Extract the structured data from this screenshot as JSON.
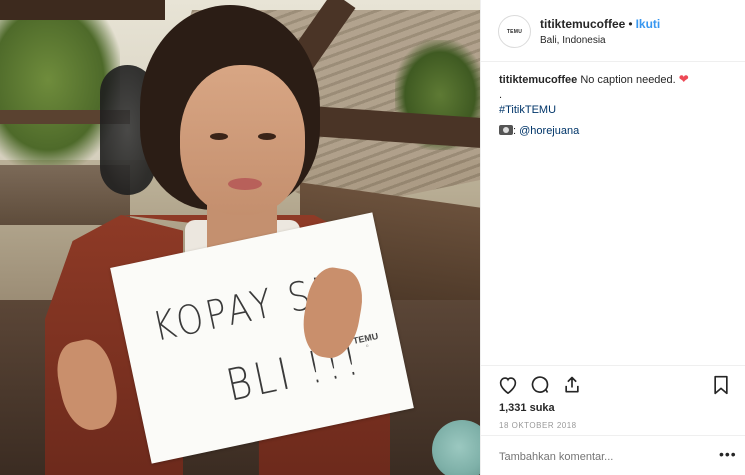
{
  "post": {
    "user": {
      "username": "titiktemucoffee",
      "separator": "•",
      "follow_label": "Ikuti",
      "location": "Bali, Indonesia",
      "avatar_text": "TEMU"
    },
    "caption": {
      "username": "titiktemucoffee",
      "text": "No caption needed.",
      "line2": ".",
      "hashtag": "#TitikTEMU",
      "credit_handle": "@horejuana"
    },
    "photo": {
      "sign_line_1": "KOPAY SIK",
      "sign_line_2": "BLI !!!",
      "sign_logo": "TEMU"
    },
    "stats": {
      "likes": "1,331 suka",
      "date": "18 OKTOBER 2018"
    },
    "comment": {
      "placeholder": "Tambahkan komentar...",
      "more_label": "•••"
    },
    "icons": {
      "like": "heart-icon",
      "comment": "comment-icon",
      "share": "share-icon",
      "save": "bookmark-icon",
      "caption_emoji": "red-heart",
      "credit_emoji": "camera"
    },
    "colors": {
      "link": "#3897f0",
      "hashtag": "#003569",
      "heart": "#ed4956"
    }
  }
}
